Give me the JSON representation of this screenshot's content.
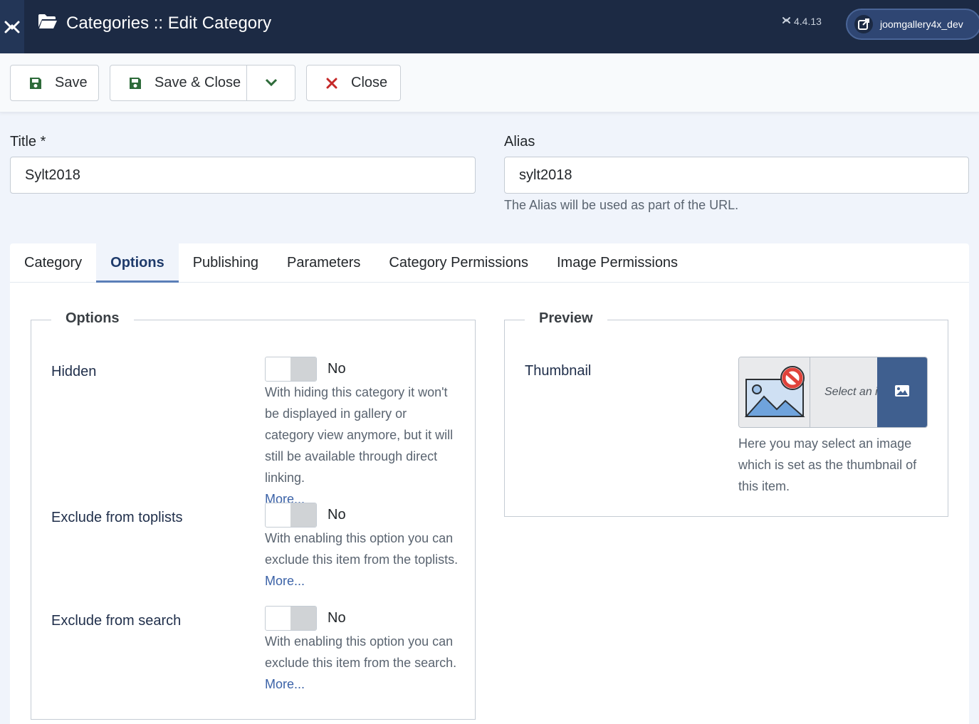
{
  "header": {
    "title": "Categories :: Edit Category",
    "version": "4.4.13",
    "site_name": "joomgallery4x_dev"
  },
  "toolbar": {
    "save_label": "Save",
    "save_close_label": "Save & Close",
    "close_label": "Close"
  },
  "form": {
    "title_label": "Title *",
    "title_value": "Sylt2018",
    "alias_label": "Alias",
    "alias_value": "sylt2018",
    "alias_help": "The Alias will be used as part of the URL."
  },
  "tabs": [
    {
      "label": "Category"
    },
    {
      "label": "Options"
    },
    {
      "label": "Publishing"
    },
    {
      "label": "Parameters"
    },
    {
      "label": "Category Permissions"
    },
    {
      "label": "Image Permissions"
    }
  ],
  "options": {
    "legend": "Options",
    "hidden": {
      "label": "Hidden",
      "value": "No",
      "desc": "With hiding this category it won't be displayed in gallery or category view anymore, but it will still be available through direct linking.",
      "more": "More..."
    },
    "toplists": {
      "label": "Exclude from toplists",
      "value": "No",
      "desc": "With enabling this option you can exclude this item from the toplists.",
      "more": "More..."
    },
    "search": {
      "label": "Exclude from search",
      "value": "No",
      "desc": "With enabling this option you can exclude this item from the search.",
      "more": "More..."
    }
  },
  "preview": {
    "legend": "Preview",
    "thumb_label": "Thumbnail",
    "select_text": "Select an image",
    "thumb_desc": "Here you may select an image which is set as the thumbnail of this item."
  },
  "colors": {
    "header_bg": "#1c2a44",
    "accent": "#3f5f8f",
    "link": "#3b62a7",
    "save_icon": "#2e6b3a",
    "close_icon": "#c52828"
  }
}
